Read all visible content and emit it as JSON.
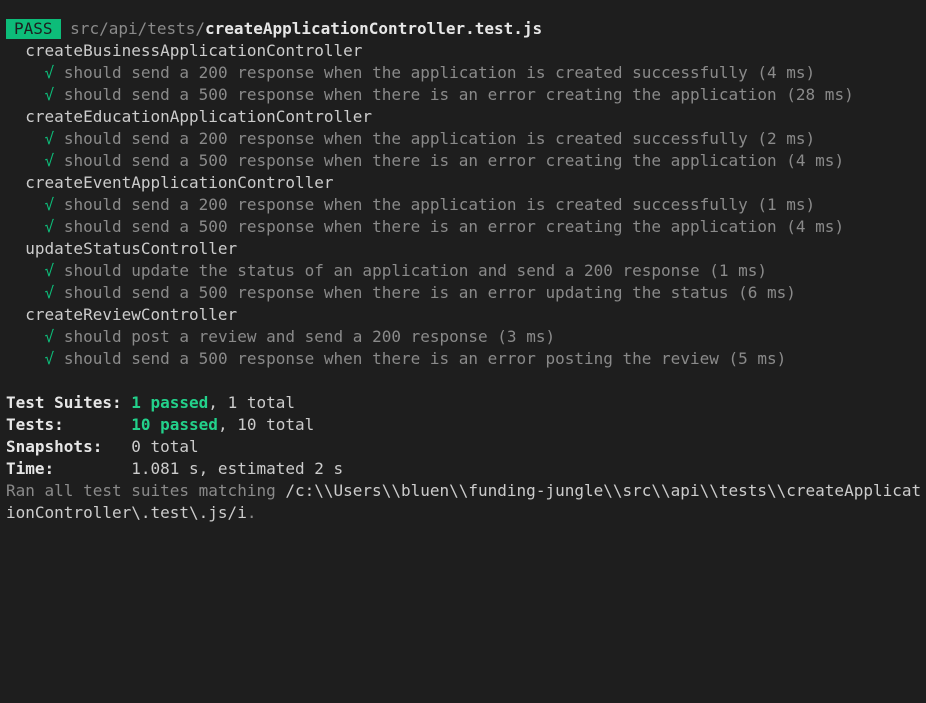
{
  "header": {
    "badge": "PASS",
    "path_dir": "src/api/tests/",
    "path_file": "createApplicationController.test.js"
  },
  "suites": [
    {
      "name": "createBusinessApplicationController",
      "tests": [
        {
          "check": "√",
          "text": "should send a 200 response when the application is created successfully (4 ms)"
        },
        {
          "check": "√",
          "text": "should send a 500 response when there is an error creating the application (28 ms)"
        }
      ]
    },
    {
      "name": "createEducationApplicationController",
      "tests": [
        {
          "check": "√",
          "text": "should send a 200 response when the application is created successfully (2 ms)"
        },
        {
          "check": "√",
          "text": "should send a 500 response when there is an error creating the application (4 ms)"
        }
      ]
    },
    {
      "name": "createEventApplicationController",
      "tests": [
        {
          "check": "√",
          "text": "should send a 200 response when the application is created successfully (1 ms)"
        },
        {
          "check": "√",
          "text": "should send a 500 response when there is an error creating the application (4 ms)"
        }
      ]
    },
    {
      "name": "updateStatusController",
      "tests": [
        {
          "check": "√",
          "text": "should update the status of an application and send a 200 response (1 ms)"
        },
        {
          "check": "√",
          "text": "should send a 500 response when there is an error updating the status (6 ms)"
        }
      ]
    },
    {
      "name": "createReviewController",
      "tests": [
        {
          "check": "√",
          "text": "should post a review and send a 200 response (3 ms)"
        },
        {
          "check": "√",
          "text": "should send a 500 response when there is an error posting the review (5 ms)"
        }
      ]
    }
  ],
  "summary": {
    "suites_label": "Test Suites:",
    "suites_passed": "1 passed",
    "suites_rest": ", 1 total",
    "tests_label": "Tests:",
    "tests_passed": "10 passed",
    "tests_rest": ", 10 total",
    "snapshots_label": "Snapshots:",
    "snapshots_value": "0 total",
    "time_label": "Time:",
    "time_value": "1.081 s, estimated 2 s",
    "ran_prefix": "Ran all test suites matching ",
    "ran_pattern_line1": "/c:\\\\Users\\\\bluen\\\\funding-jungle\\\\src\\\\api\\\\tests\\\\createApplicat",
    "ran_pattern_line2": "ionController\\.test\\.js/i",
    "ran_suffix": "."
  },
  "colors": {
    "background": "#1e1e1e",
    "pass_badge": "#0dbc79",
    "check": "#0dbc79",
    "passed_count": "#23d18b"
  }
}
